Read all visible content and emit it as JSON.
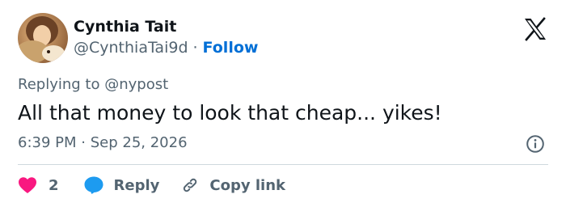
{
  "tweet": {
    "author": {
      "display_name": "Cynthia Tait",
      "handle": "@CynthiaTai9d",
      "separator": "·",
      "follow_label": "Follow",
      "avatar_icon": "profile-photo"
    },
    "platform_logo": "x-logo",
    "replying_prefix": "Replying to",
    "replying_to": "@nypost",
    "text": "All that money to look that cheap... yikes!",
    "time": "6:39 PM",
    "date_separator": "·",
    "date": "Sep 25, 2026",
    "info_icon": "info-icon",
    "actions": {
      "like_count": "2",
      "reply_label": "Reply",
      "copy_label": "Copy link"
    }
  },
  "colors": {
    "text_primary": "#0f1419",
    "text_secondary": "#536471",
    "follow_link": "#006fd6",
    "heart": "#f91880",
    "reply_bubble": "#1d9bf0",
    "divider": "#cfd9de"
  }
}
